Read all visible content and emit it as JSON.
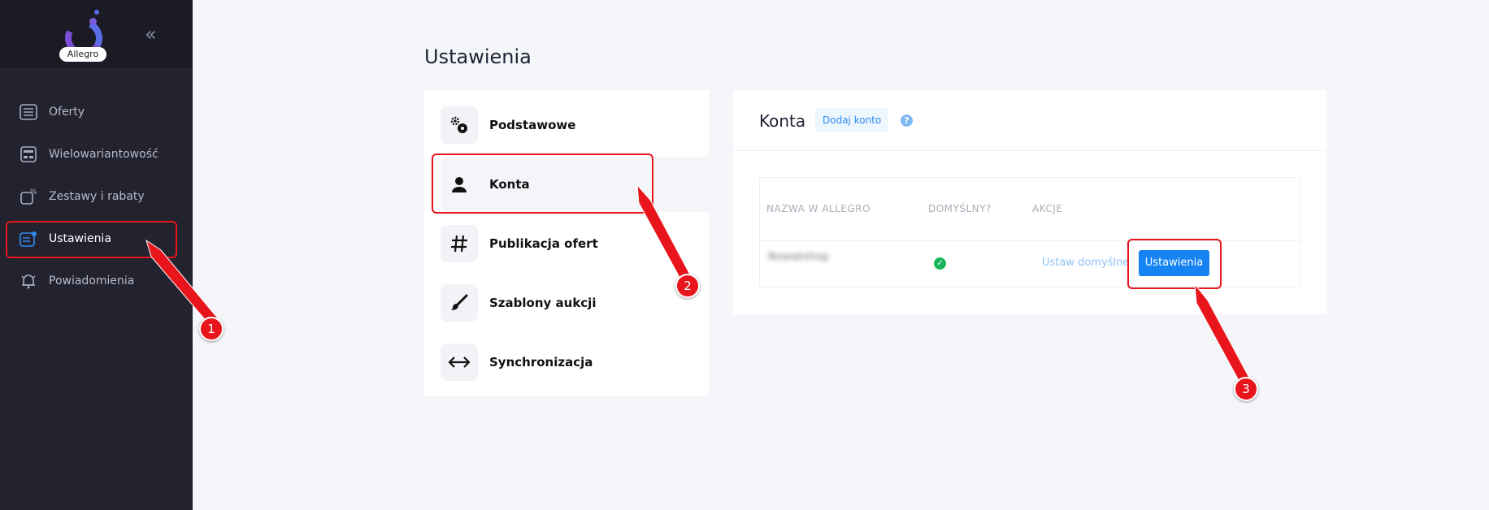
{
  "app": {
    "logo_text": "Allegro",
    "collapse_glyph": "«"
  },
  "sidebar": {
    "items": [
      {
        "label": "Oferty",
        "icon": "list-icon"
      },
      {
        "label": "Wielowariantowość",
        "icon": "variants-icon"
      },
      {
        "label": "Zestawy i rabaty",
        "icon": "discount-icon"
      },
      {
        "label": "Ustawienia",
        "icon": "settings-list-icon",
        "active": true
      },
      {
        "label": "Powiadomienia",
        "icon": "bell-icon"
      }
    ]
  },
  "page": {
    "title": "Ustawienia"
  },
  "settings_menu": {
    "items": [
      {
        "label": "Podstawowe",
        "icon": "gears-icon"
      },
      {
        "label": "Konta",
        "icon": "user-icon",
        "active": true
      },
      {
        "label": "Publikacja ofert",
        "icon": "hashtag-icon"
      },
      {
        "label": "Szablony aukcji",
        "icon": "brush-icon"
      },
      {
        "label": "Synchronizacja",
        "icon": "arrows-horizontal-icon"
      }
    ]
  },
  "accounts": {
    "title": "Konta",
    "add_label": "Dodaj konto",
    "help_glyph": "?",
    "columns": [
      "NAZWA W ALLEGRO",
      "DOMYŚLNY?",
      "AKCJE"
    ],
    "row": {
      "name": "Nowakshop",
      "default_glyph": "✓",
      "set_default_label": "Ustaw domyślne",
      "settings_label": "Ustawienia"
    }
  },
  "callouts": [
    "1",
    "2",
    "3"
  ],
  "colors": {
    "accent": "#1683f2",
    "highlight": "#e8161c",
    "sidebar_bg": "#23232f",
    "success": "#19b45a"
  }
}
